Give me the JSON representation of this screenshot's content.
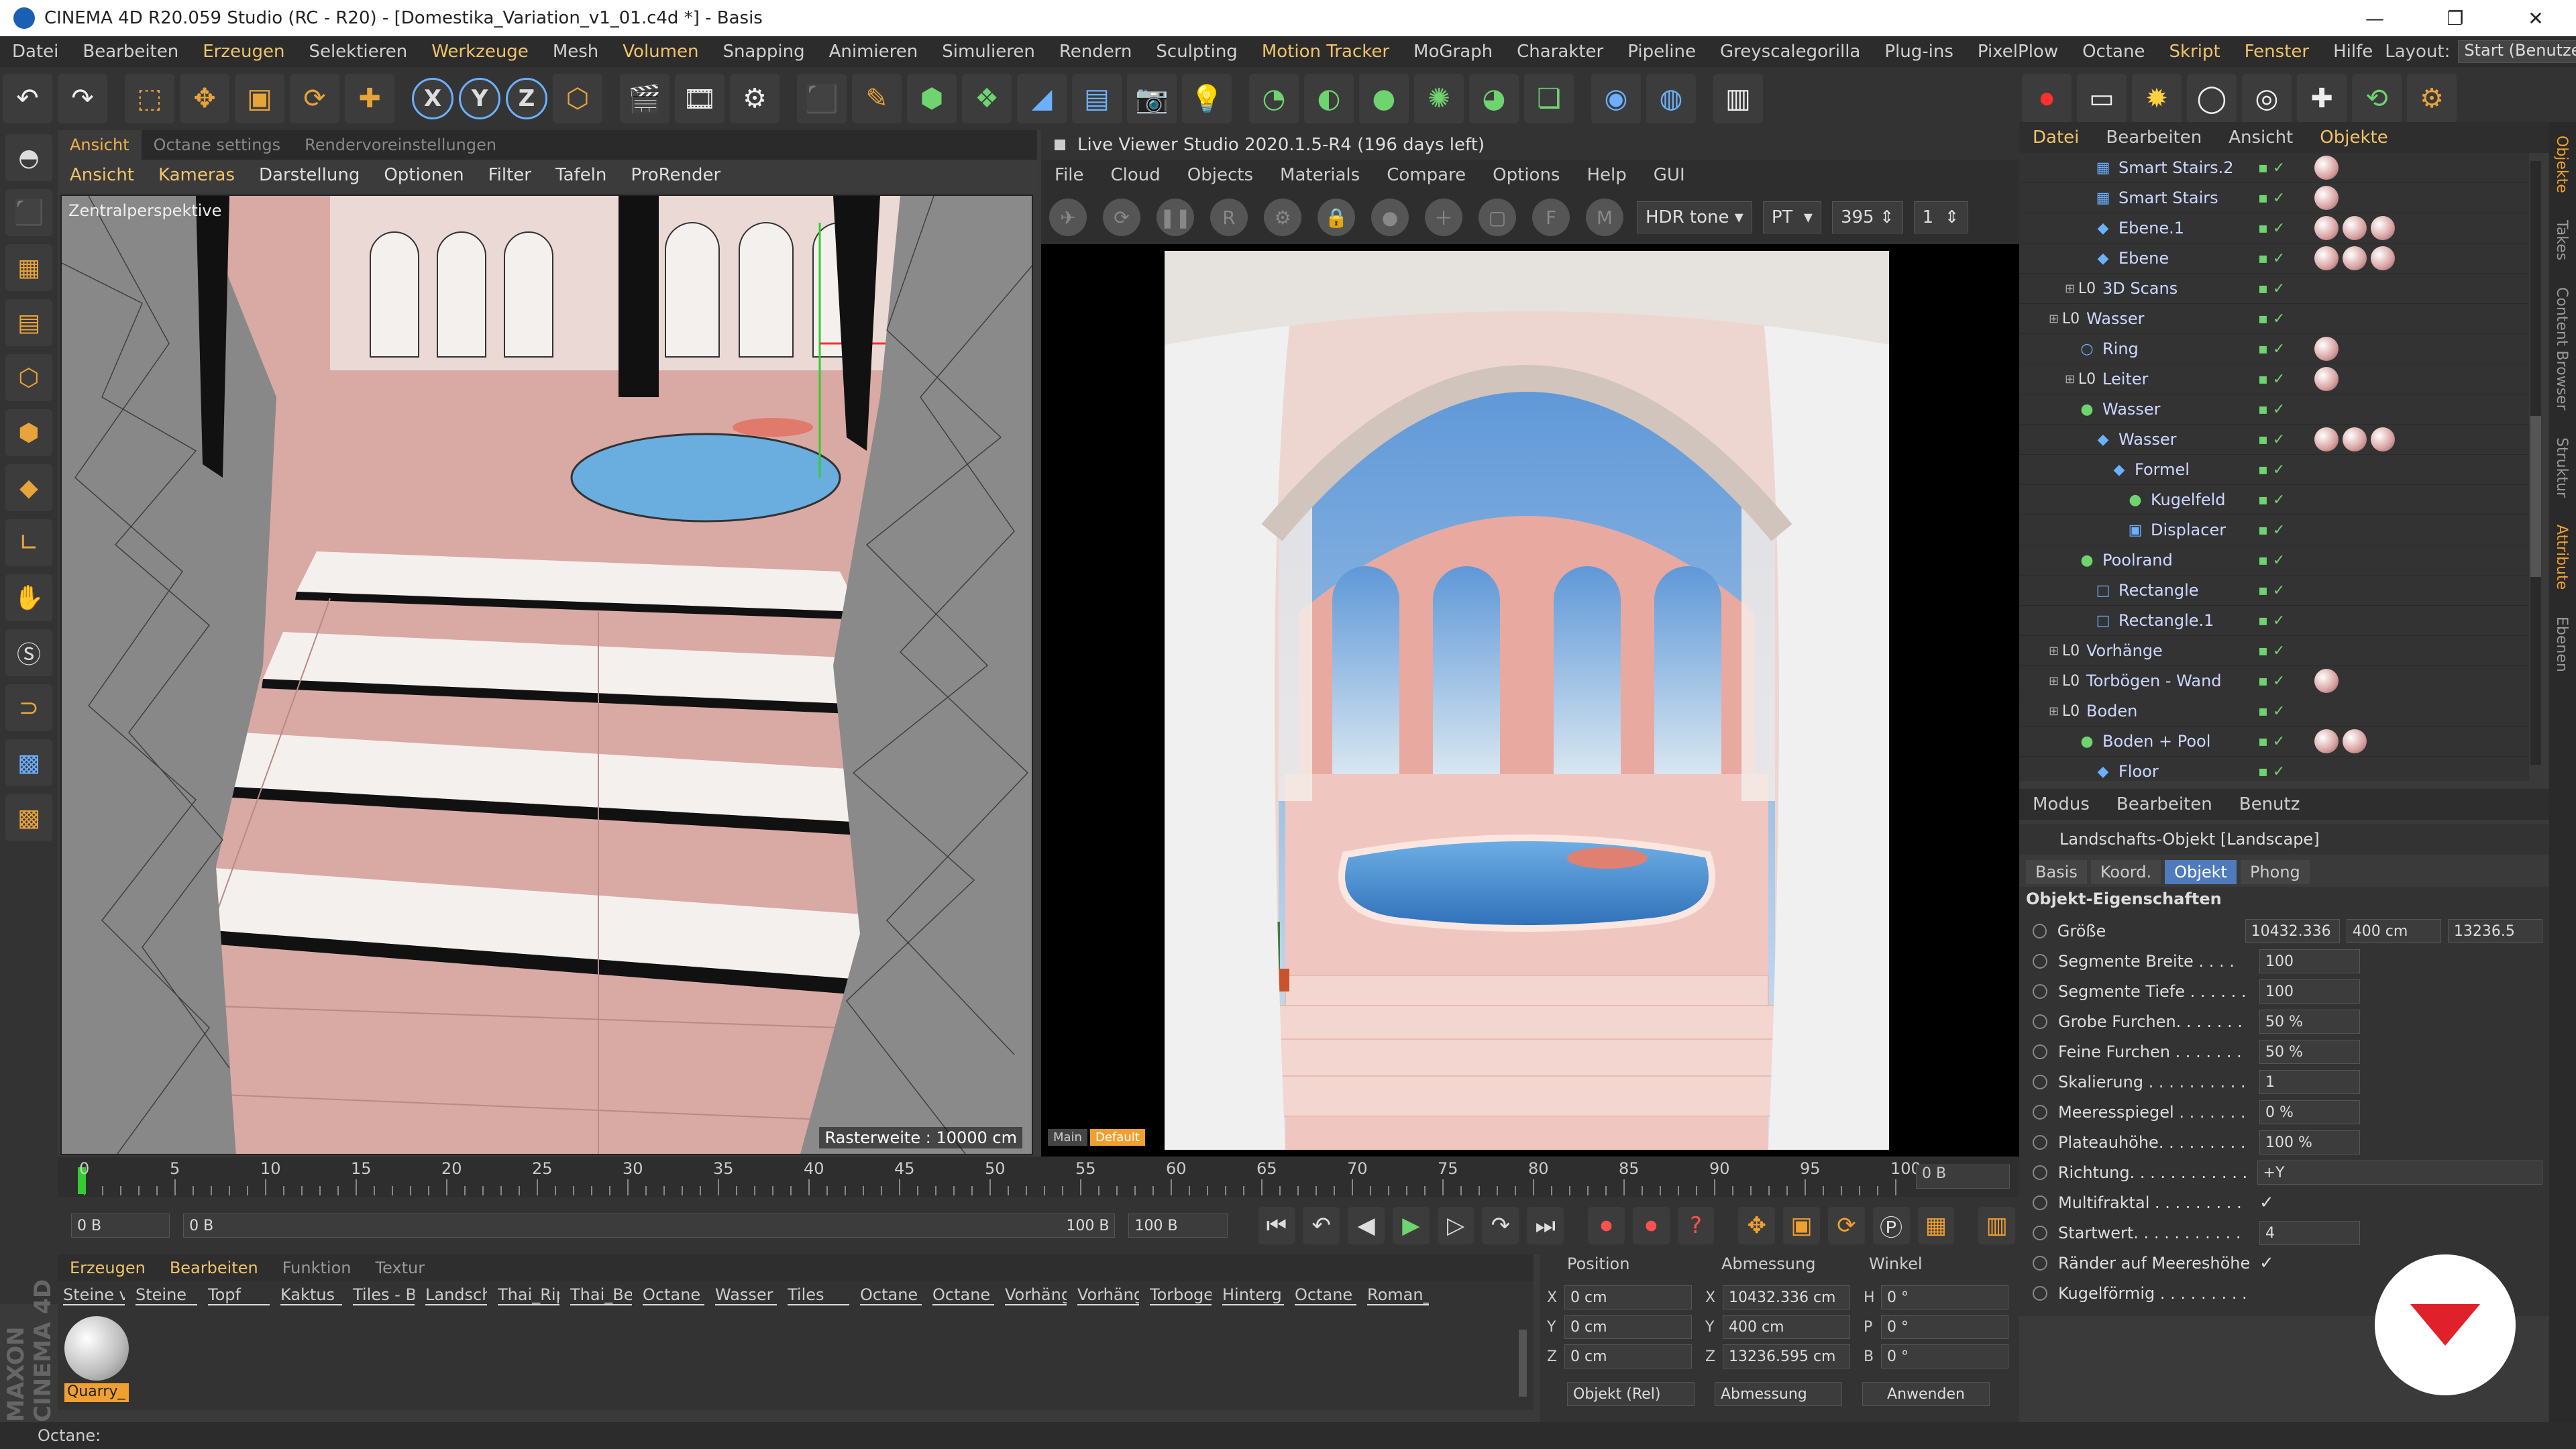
{
  "titlebar": {
    "title": "CINEMA 4D R20.059 Studio (RC - R20) - [Domestika_Variation_v1_01.c4d *] - Basis",
    "min": "—",
    "max": "❐",
    "close": "✕"
  },
  "menubar": {
    "items": [
      "Datei",
      "Bearbeiten",
      "Erzeugen",
      "Selektieren",
      "Werkzeuge",
      "Mesh",
      "Volumen",
      "Snapping",
      "Animieren",
      "Simulieren",
      "Rendern",
      "Sculpting",
      "Motion Tracker",
      "MoGraph",
      "Charakter",
      "Pipeline",
      "Greyscalegorilla",
      "Plug-ins",
      "PixelPlow",
      "Octane",
      "Skript",
      "Fenster",
      "Hilfe"
    ],
    "layout_label": "Layout:",
    "layout_value": "Start (Benutzer)"
  },
  "viewport": {
    "tabs": [
      "Ansicht",
      "Octane settings",
      "Rendervoreinstellungen"
    ],
    "menu": [
      "Ansicht",
      "Kameras",
      "Darstellung",
      "Optionen",
      "Filter",
      "Tafeln",
      "ProRender"
    ],
    "perspective_label": "Zentralperspektive",
    "grid_label": "Rasterweite : 10000 cm"
  },
  "live_viewer": {
    "title": "Live Viewer Studio 2020.1.5-R4 (196 days left)",
    "menu": [
      "File",
      "Cloud",
      "Objects",
      "Materials",
      "Compare",
      "Options",
      "Help",
      "GUI"
    ],
    "tonemap": "HDR tone",
    "mode": "PT",
    "samples": "395",
    "count": "1",
    "tags": [
      "Main",
      "Default"
    ]
  },
  "timeline": {
    "ticks": [
      "0",
      "5",
      "10",
      "15",
      "20",
      "25",
      "30",
      "35",
      "40",
      "45",
      "50",
      "55",
      "60",
      "65",
      "70",
      "75",
      "80",
      "85",
      "90",
      "95",
      "100"
    ],
    "current": "0 B",
    "start": "0 B",
    "range_start": "0 B",
    "range_end": "100 B",
    "end": "100 B"
  },
  "materials": {
    "tabs": [
      "Erzeugen",
      "Bearbeiten",
      "Funktion",
      "Textur"
    ],
    "items": [
      "Steine v",
      "Steine",
      "Topf",
      "Kaktus",
      "Tiles - Bi",
      "Landsch",
      "Thai_Rip",
      "Thai_Be",
      "Octane",
      "Wasser",
      "Tiles",
      "Octane",
      "Octane",
      "Vorhäng",
      "Vorhäng",
      "Torboge",
      "Hinterg",
      "Octane",
      "Roman_"
    ],
    "selected": "Quarry_"
  },
  "coords": {
    "headers": [
      "Position",
      "Abmessung",
      "Winkel"
    ],
    "pos": [
      "0 cm",
      "0 cm",
      "0 cm"
    ],
    "size": [
      "10432.336 cm",
      "400 cm",
      "13236.595 cm"
    ],
    "angle": [
      "0 °",
      "0 °",
      "0 °"
    ],
    "axes_pos": [
      "X",
      "Y",
      "Z"
    ],
    "axes_size": [
      "X",
      "Y",
      "Z"
    ],
    "axes_ang": [
      "H",
      "P",
      "B"
    ],
    "mode": "Objekt (Rel)",
    "size_mode": "Abmessung",
    "apply": "Anwenden"
  },
  "objects": {
    "tabs": [
      "Datei",
      "Bearbeiten",
      "Ansicht",
      "Objekte"
    ],
    "rows": [
      {
        "name": "Smart Stairs.2",
        "indent": 3,
        "icon": "▦",
        "mats": 1
      },
      {
        "name": "Smart Stairs",
        "indent": 3,
        "icon": "▦",
        "mats": 1
      },
      {
        "name": "Ebene.1",
        "indent": 3,
        "icon": "◆",
        "mats": 3
      },
      {
        "name": "Ebene",
        "indent": 3,
        "icon": "◆",
        "mats": 3
      },
      {
        "name": "3D Scans",
        "indent": 2,
        "icon": "L0",
        "mats": 0
      },
      {
        "name": "Wasser",
        "indent": 1,
        "icon": "L0",
        "mats": 0
      },
      {
        "name": "Ring",
        "indent": 2,
        "icon": "○",
        "mats": 1
      },
      {
        "name": "Leiter",
        "indent": 2,
        "icon": "L0",
        "mats": 1
      },
      {
        "name": "Wasser",
        "indent": 2,
        "icon": "●",
        "mats": 0
      },
      {
        "name": "Wasser",
        "indent": 3,
        "icon": "◆",
        "mats": 3
      },
      {
        "name": "Formel",
        "indent": 4,
        "icon": "◆",
        "mats": 0
      },
      {
        "name": "Kugelfeld",
        "indent": 5,
        "icon": "●",
        "mats": 0
      },
      {
        "name": "Displacer",
        "indent": 5,
        "icon": "▣",
        "mats": 0
      },
      {
        "name": "Poolrand",
        "indent": 2,
        "icon": "●",
        "mats": 0
      },
      {
        "name": "Rectangle",
        "indent": 3,
        "icon": "□",
        "mats": 0
      },
      {
        "name": "Rectangle.1",
        "indent": 3,
        "icon": "□",
        "mats": 0
      },
      {
        "name": "Vorhänge",
        "indent": 1,
        "icon": "L0",
        "mats": 0
      },
      {
        "name": "Torbögen - Wand",
        "indent": 1,
        "icon": "L0",
        "mats": 1
      },
      {
        "name": "Boden",
        "indent": 1,
        "icon": "L0",
        "mats": 0
      },
      {
        "name": "Boden + Pool",
        "indent": 2,
        "icon": "●",
        "mats": 2
      },
      {
        "name": "Floor",
        "indent": 3,
        "icon": "◆",
        "mats": 0
      }
    ]
  },
  "attributes": {
    "tabs": [
      "Modus",
      "Bearbeiten",
      "Benutz"
    ],
    "title": "Landschafts-Objekt [Landscape]",
    "subtabs": [
      "Basis",
      "Koord.",
      "Objekt",
      "Phong"
    ],
    "section": "Objekt-Eigenschaften",
    "rows": [
      {
        "label": "Größe",
        "values": [
          "10432.336",
          "400 cm",
          "13236.5"
        ]
      },
      {
        "label": "Segmente Breite . . . .",
        "values": [
          "100"
        ]
      },
      {
        "label": "Segmente Tiefe . . . . . .",
        "values": [
          "100"
        ]
      },
      {
        "label": "Grobe Furchen. . . . . . .",
        "values": [
          "50 %"
        ]
      },
      {
        "label": "Feine Furchen . . . . . . .",
        "values": [
          "50 %"
        ]
      },
      {
        "label": "Skalierung . . . . . . . . . .",
        "values": [
          "1"
        ]
      },
      {
        "label": "Meeresspiegel . . . . . . .",
        "values": [
          "0 %"
        ]
      },
      {
        "label": "Plateauhöhe. . . . . . . . .",
        "values": [
          "100 %"
        ]
      },
      {
        "label": "Richtung. . . . . . . . . . . .",
        "values": [
          "+Y"
        ]
      },
      {
        "label": "Multifraktal . . . . . . . . .",
        "check": "✓"
      },
      {
        "label": "Startwert. . . . . . . . . . .",
        "values": [
          "4"
        ]
      },
      {
        "label": "Ränder auf Meereshöhe",
        "check": "✓"
      },
      {
        "label": "Kugelförmig . . . . . . . . .",
        "check": " "
      }
    ]
  },
  "sidetabs": [
    "Objekte",
    "Takes",
    "Content Browser",
    "Struktur",
    "Attribute",
    "Ebenen"
  ],
  "statusbar": "Octane:",
  "maxon": "MAXON CINEMA 4D"
}
